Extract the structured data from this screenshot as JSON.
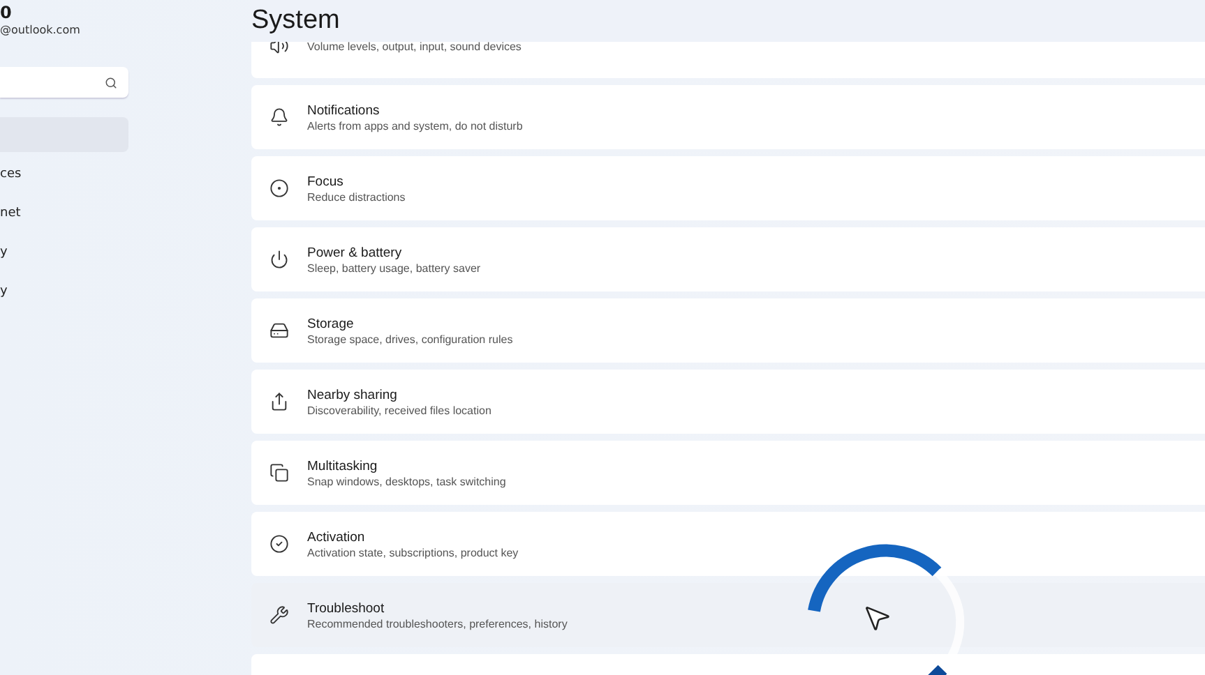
{
  "account": {
    "name": "0",
    "email": "@outlook.com"
  },
  "sidebar": {
    "items": [
      {
        "selected": true
      },
      {
        "label": "ces",
        "selected": false
      },
      {
        "label": "net",
        "selected": false
      },
      {
        "label": "y",
        "selected": false
      },
      {
        "label": "y",
        "selected": false
      }
    ]
  },
  "page": {
    "title": "System"
  },
  "settings": [
    {
      "kind": "sound",
      "description": "Volume levels, output, input, sound devices",
      "hovered": false
    },
    {
      "kind": "bell",
      "title": "Notifications",
      "description": "Alerts from apps and system, do not disturb",
      "hovered": false
    },
    {
      "kind": "focus",
      "title": "Focus",
      "description": "Reduce distractions",
      "hovered": false
    },
    {
      "kind": "power",
      "title": "Power & battery",
      "description": "Sleep, battery usage, battery saver",
      "hovered": false
    },
    {
      "kind": "storage",
      "title": "Storage",
      "description": "Storage space, drives, configuration rules",
      "hovered": false
    },
    {
      "kind": "share",
      "title": "Nearby sharing",
      "description": "Discoverability, received files location",
      "hovered": false
    },
    {
      "kind": "multitask",
      "title": "Multitasking",
      "description": "Snap windows, desktops, task switching",
      "hovered": false
    },
    {
      "kind": "check",
      "title": "Activation",
      "description": "Activation state, subscriptions, product key",
      "hovered": false
    },
    {
      "kind": "wrench",
      "title": "Troubleshoot",
      "description": "Recommended troubleshooters, preferences, history",
      "hovered": true
    },
    {
      "kind": "blank",
      "hovered": false
    }
  ],
  "busy": true
}
